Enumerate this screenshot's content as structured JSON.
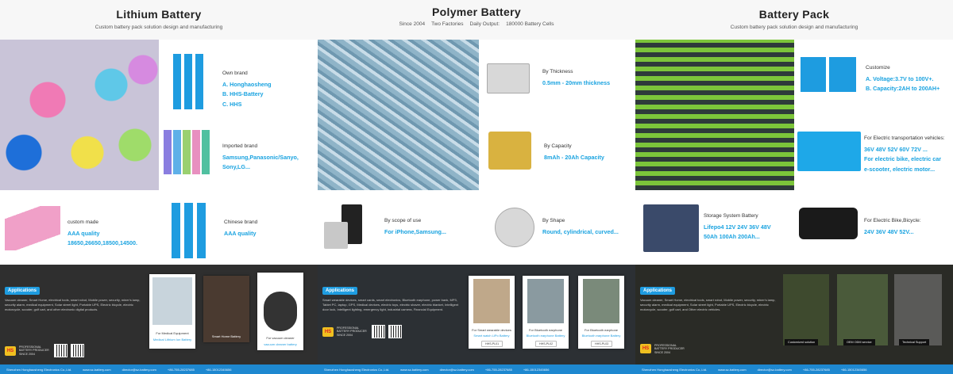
{
  "lithium": {
    "title": "Lithium Battery",
    "subtitle": "Custom battery pack solution design and manufacturing",
    "own": {
      "label": "Own brand",
      "a": "A. Honghaosheng",
      "b": "B. HHS-Battery",
      "c": "C. HHS"
    },
    "imported": {
      "label": "Imported brand",
      "l1": "Samsung,Panasonic/Sanyo,",
      "l2": "Sony,LG..."
    },
    "custom": {
      "label": "custom made",
      "l1": "AAA quality",
      "l2": "18650,26650,18500,14500."
    },
    "chinese": {
      "label": "Chinese brand",
      "l1": "AAA quality"
    }
  },
  "polymer": {
    "title": "Polymer Battery",
    "since": "Since 2004",
    "factories": "Two Factories",
    "output": "Daily Output:",
    "cells": "180000 Battery Cells",
    "thickness": {
      "label": "By Thickness",
      "value": "0.5mm  -  20mm thickness"
    },
    "capacity": {
      "label": "By Capacity",
      "value": "8mAh - 20Ah Capacity"
    },
    "scope": {
      "label": "By scope of use",
      "value": "For iPhone,Samsung..."
    },
    "shape": {
      "label": "By Shape",
      "value": "Round, cylindrical, curved..."
    }
  },
  "pack": {
    "title": "Battery Pack",
    "subtitle": "Custom battery pack solution design and manufacturing",
    "customize": {
      "label": "Customize",
      "a": "A. Voltage:3.7V to 100V+.",
      "b": "B. Capacity:2AH to 200AH+"
    },
    "transport": {
      "label": "For Electric transportation vehicles:",
      "l1": "36V 48V 52V 60V 72V ...",
      "l2": "For electric bike, electric car",
      "l3": "e-scooter, electric motor..."
    },
    "storage": {
      "label": "Storage System Battery",
      "l1": "Lifepo4 12V 24V 36V 48V",
      "l2": "50Ah 100Ah 200Ah..."
    },
    "ebike": {
      "label": "For Electric Bike,Bicycle:",
      "l1": "24V 36V 48V 52V..."
    }
  },
  "apps": {
    "badge": "Applications",
    "text1": "Vacuum cleaner, Smart Home, electrical tools, smart robot, Mobile power, security, miner's lamp, security alarm, medical equipment, Solar street light, Portable UPS, Electric bicycle, electric motorcycle, scooter, golf cart, and other electronic digital products.",
    "text2": "Smart wearable devices, smart cards, smart electronics, Bluetooth earphone, power bank, MP3, Tablet PC, laptop, GPS, Medical devices, electric toys, electric shaver, electric blanket, Intelligent door lock, Intelligent lighting, emergency light, industrial camera, Financial Equipment.",
    "text3": "Vacuum cleaner, Smart Home, electrical tools, smart robot, Mobile power, security, miner's lamp, security alarm, medical equipment, Solar street light, Portable UPS, Electric bicycle, electric motorcycle, scooter, golf cart, and Other electric vehicles.",
    "brand": "PROFESSIONAL BATTERY PRODUCER SINCE 2004",
    "c1a": "For Medical Equipment",
    "c1b": "Medical Lithium Ion Battery",
    "c1c": "Smart Home Battery",
    "c1d": "For vacuum cleaner",
    "c1e": "vacuum cleaner battery",
    "c2a": "For Smart wearable devices",
    "c2b": "Smart watch LiPo Battery",
    "c2c": "For Bluetooth earphone",
    "c2d": "Bluetooth earphone Battery",
    "c2e": "For Bluetooth earphone",
    "c2f": "Bluetooth earphone Battery",
    "p1": "HHS-PL01",
    "p2": "HHS-PL02",
    "p3": "HHS-PL03",
    "c3a": "Customized solution",
    "c3b": "OEM ODM service",
    "c3c": "Technical Support"
  },
  "footer": {
    "company": "Shenzhen Honghaosheng Electronics Co.,Ltd.",
    "web": "www.sz-battery.com",
    "mail": "director@sz-battery.com",
    "phone": "+86-755-28237685",
    "mobile": "+86-15012345656"
  }
}
